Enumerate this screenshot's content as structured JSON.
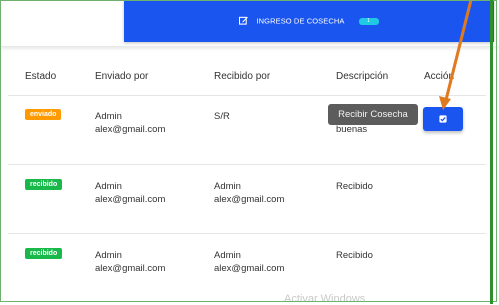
{
  "banner": {
    "title": "INGRESO DE COSECHA",
    "badge": "1"
  },
  "table": {
    "headers": [
      "Estado",
      "Enviado por",
      "Recibido por",
      "Descripción",
      "Acción"
    ],
    "rows": [
      {
        "status": "enviado",
        "sender_name": "Admin",
        "sender_email": "alex@gmail.com",
        "receiver": "S/R",
        "receiver_email": "",
        "description": "buenas",
        "has_action": true
      },
      {
        "status": "recibido",
        "sender_name": "Admin",
        "sender_email": "alex@gmail.com",
        "receiver": "Admin",
        "receiver_email": "alex@gmail.com",
        "description": "Recibido",
        "has_action": false
      },
      {
        "status": "recibido",
        "sender_name": "Admin",
        "sender_email": "alex@gmail.com",
        "receiver": "Admin",
        "receiver_email": "alex@gmail.com",
        "description": "Recibido",
        "has_action": false
      }
    ]
  },
  "tooltip": {
    "text": "Recibir Cosecha"
  },
  "watermark": {
    "text": "Activar Windows"
  },
  "colors": {
    "primary": "#1a55f0",
    "enviado": "#ff9a00",
    "recibido": "#18b84a",
    "annotation_arrow": "#e07a1f"
  },
  "icons": {
    "banner": "edit-icon",
    "action": "check-square-icon"
  }
}
